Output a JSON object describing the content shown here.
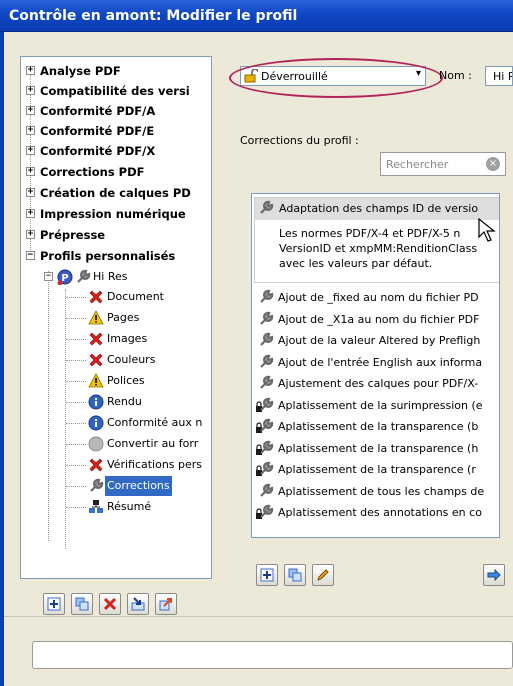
{
  "window": {
    "title": "Contrôle en amont: Modifier le profil"
  },
  "tree": {
    "items": [
      {
        "label": "Analyse PDF",
        "level": 0,
        "expanded": false
      },
      {
        "label": "Compatibilité des versi",
        "level": 0,
        "expanded": false
      },
      {
        "label": "Conformité PDF/A",
        "level": 0,
        "expanded": false
      },
      {
        "label": "Conformité PDF/E",
        "level": 0,
        "expanded": false
      },
      {
        "label": "Conformité PDF/X",
        "level": 0,
        "expanded": false
      },
      {
        "label": "Corrections PDF",
        "level": 0,
        "expanded": false
      },
      {
        "label": "Création de calques PD",
        "level": 0,
        "expanded": false
      },
      {
        "label": "Impression numérique",
        "level": 0,
        "expanded": false
      },
      {
        "label": "Prépresse",
        "level": 0,
        "expanded": false
      },
      {
        "label": "Profils personnalisés",
        "level": 0,
        "expanded": true
      }
    ],
    "profile": {
      "label": "Hi Res",
      "expanded": true
    },
    "children": [
      {
        "label": "Document",
        "icon": "red-x-icon"
      },
      {
        "label": "Pages",
        "icon": "warning-icon"
      },
      {
        "label": "Images",
        "icon": "red-x-icon"
      },
      {
        "label": "Couleurs",
        "icon": "red-x-icon"
      },
      {
        "label": "Polices",
        "icon": "warning-icon"
      },
      {
        "label": "Rendu",
        "icon": "info-icon"
      },
      {
        "label": "Conformité aux n",
        "icon": "info-icon"
      },
      {
        "label": "Convertir au forr",
        "icon": "gray-circle-icon"
      },
      {
        "label": "Vérifications pers",
        "icon": "red-x-icon"
      },
      {
        "label": "Corrections",
        "icon": "wrench-icon",
        "selected": true
      },
      {
        "label": "Résumé",
        "icon": "summary-icon"
      }
    ]
  },
  "profile_header": {
    "lock_state": "Déverrouillé",
    "name_label": "Nom :",
    "name_value": "Hi Res"
  },
  "corrections": {
    "label": "Corrections du profil :",
    "search_placeholder": "Rechercher",
    "expanded": {
      "title": "Adaptation des champs ID de versio",
      "desc_lines": [
        "Les normes PDF/X-4 et PDF/X-5 n",
        "VersionID et xmpMM:RenditionClass",
        "avec les valeurs par défaut."
      ]
    },
    "items": [
      {
        "label": "Ajout de _fixed au nom du fichier PD",
        "locked": false
      },
      {
        "label": "Ajout de _X1a au nom du fichier PDF",
        "locked": false
      },
      {
        "label": "Ajout de la valeur Altered by Prefligh",
        "locked": false
      },
      {
        "label": "Ajout de l'entrée English aux informa",
        "locked": false
      },
      {
        "label": "Ajustement des calques pour PDF/X-",
        "locked": false
      },
      {
        "label": "Aplatissement de la surimpression (e",
        "locked": true
      },
      {
        "label": "Aplatissement de la transparence (b",
        "locked": true
      },
      {
        "label": "Aplatissement de la transparence (h",
        "locked": true
      },
      {
        "label": "Aplatissement de la transparence (r",
        "locked": true
      },
      {
        "label": "Aplatissement de tous les champs de",
        "locked": false
      },
      {
        "label": "Aplatissement des annotations en co",
        "locked": true
      }
    ]
  },
  "colors": {
    "title_bar": "#0f47c5",
    "selection": "#316ac5",
    "highlight_ellipse": "#b3215c"
  }
}
